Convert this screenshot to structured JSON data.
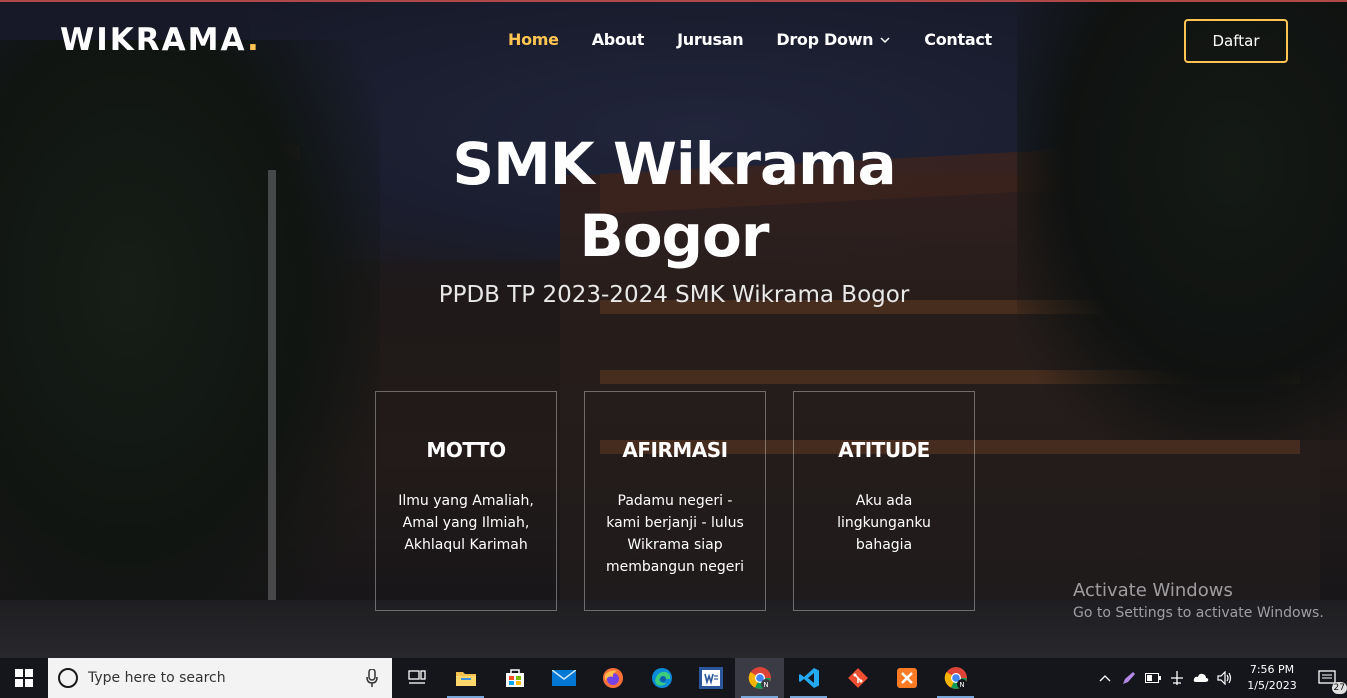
{
  "header": {
    "logo_text": "WIKRAMA",
    "logo_dot": ".",
    "nav": [
      {
        "label": "Home",
        "active": true
      },
      {
        "label": "About",
        "active": false
      },
      {
        "label": "Jurusan",
        "active": false
      },
      {
        "label": "Drop Down",
        "active": false,
        "dropdown": true
      },
      {
        "label": "Contact",
        "active": false
      }
    ],
    "cta_label": "Daftar"
  },
  "hero": {
    "title_line1": "SMK Wikrama",
    "title_line2": "Bogor",
    "subtitle": "PPDB TP 2023-2024 SMK Wikrama Bogor"
  },
  "boxes": [
    {
      "title": "MOTTO",
      "text": "Ilmu yang Amaliah, Amal yang Ilmiah, Akhlaqul Karimah"
    },
    {
      "title": "AFIRMASI",
      "text": "Padamu negeri - kami berjanji - lulus Wikrama siap membangun negeri"
    },
    {
      "title": "ATITUDE",
      "text": "Aku ada lingkunganku bahagia"
    }
  ],
  "watermark": {
    "line1": "Activate Windows",
    "line2": "Go to Settings to activate Windows."
  },
  "taskbar": {
    "search_placeholder": "Type here to search",
    "time": "7:56 PM",
    "date": "1/5/2023",
    "notification_count": "27",
    "apps": [
      "task-view-icon",
      "file-explorer-icon",
      "store-icon",
      "mail-icon",
      "firefox-icon",
      "edge-icon",
      "word-icon",
      "chrome-icon",
      "vscode-icon",
      "git-icon",
      "xampp-icon",
      "chrome-icon"
    ]
  },
  "colors": {
    "accent": "#ffc451",
    "text": "#ffffff",
    "taskbar_bg": "#15161c"
  }
}
